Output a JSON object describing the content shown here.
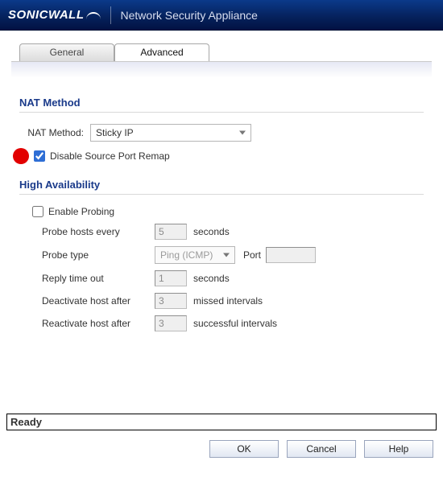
{
  "header": {
    "brand_left": "SONIC",
    "brand_right": "WALL",
    "product": "Network Security Appliance"
  },
  "tabs": {
    "general": "General",
    "advanced": "Advanced",
    "active": "advanced"
  },
  "nat": {
    "section_title": "NAT Method",
    "method_label": "NAT Method:",
    "method_value": "Sticky IP",
    "disable_remap_checked": true,
    "disable_remap_label": "Disable Source Port Remap"
  },
  "ha": {
    "section_title": "High Availability",
    "enable_probing_checked": false,
    "enable_probing_label": "Enable Probing",
    "probe_every_label": "Probe hosts every",
    "probe_every_value": "5",
    "probe_every_unit": "seconds",
    "probe_type_label": "Probe type",
    "probe_type_value": "Ping (ICMP)",
    "port_label": "Port",
    "port_value": "",
    "reply_timeout_label": "Reply time out",
    "reply_timeout_value": "1",
    "reply_timeout_unit": "seconds",
    "deactivate_label": "Deactivate host after",
    "deactivate_value": "3",
    "deactivate_unit": "missed intervals",
    "reactivate_label": "Reactivate host after",
    "reactivate_value": "3",
    "reactivate_unit": "successful intervals"
  },
  "status": "Ready",
  "buttons": {
    "ok": "OK",
    "cancel": "Cancel",
    "help": "Help"
  }
}
